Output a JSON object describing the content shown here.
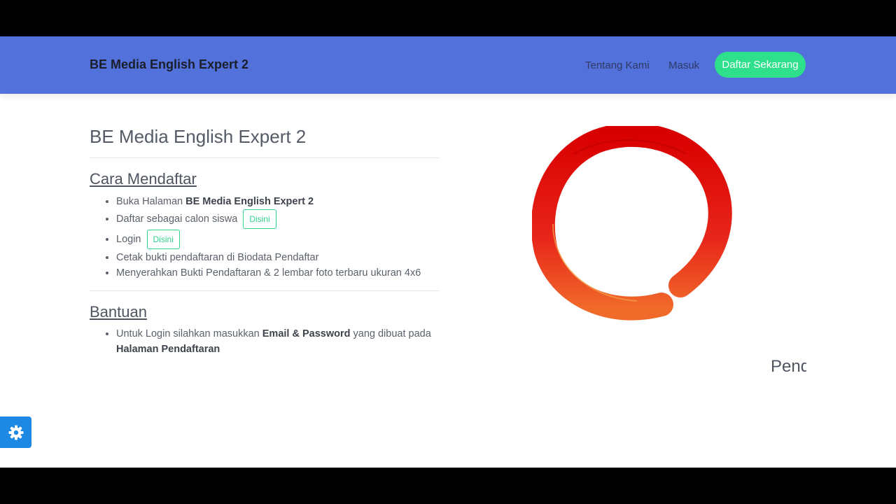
{
  "navbar": {
    "brand": "BE Media English Expert 2",
    "links": {
      "about": "Tentang Kami",
      "login": "Masuk"
    },
    "cta": "Daftar Sekarang"
  },
  "main": {
    "title": "BE Media English Expert 2",
    "how_to_register": {
      "heading": "Cara Mendaftar",
      "items": {
        "open_page_prefix": "Buka Halaman ",
        "open_page_bold": "BE Media English Expert 2",
        "register_text": "Daftar sebagai calon siswa",
        "register_button": "Disini",
        "login_text": "Login",
        "login_button": "Disini",
        "print_proof": "Cetak bukti pendaftaran di Biodata Pendaftar",
        "submit_docs": "Menyerahkan Bukti Pendaftaran & 2 lembar foto terbaru ukuran 4x6"
      }
    },
    "help": {
      "heading": "Bantuan",
      "text_prefix": "Untuk Login silahkan masukkan ",
      "text_bold1": "Email & Password",
      "text_middle": " yang dibuat pada ",
      "text_bold2": "Halaman Pendaftaran"
    },
    "peek_text": "Pendaftaran"
  },
  "icons": {
    "logo": "enso-circle-logo",
    "settings": "gear-icon"
  },
  "colors": {
    "navbar": "#5271db",
    "cta": "#2ee08c",
    "disini": "#2ed18a",
    "settings_button": "#1e88e5",
    "enso_red": "#d90000",
    "enso_orange": "#f06a2a"
  }
}
